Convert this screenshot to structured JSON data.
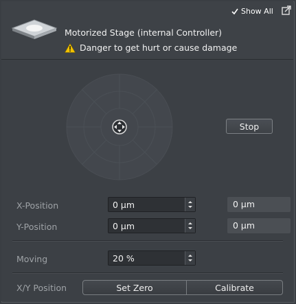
{
  "header": {
    "show_all_label": "Show All",
    "title": "Motorized Stage (internal Controller)",
    "warning": "Danger to get hurt or cause damage"
  },
  "joystick": {
    "icon": "move-crosshair-icon"
  },
  "stop_button": "Stop",
  "x_position": {
    "label": "X-Position",
    "value": "0 µm",
    "readout": "0 µm"
  },
  "y_position": {
    "label": "Y-Position",
    "value": "0 µm",
    "readout": "0 µm"
  },
  "moving": {
    "label": "Moving",
    "value": "20 %"
  },
  "xy_position": {
    "label": "X/Y Position",
    "set_zero": "Set Zero",
    "calibrate": "Calibrate"
  },
  "colors": {
    "warning": "#f2c200",
    "panel": "#3c4045",
    "field": "#2e3135"
  }
}
